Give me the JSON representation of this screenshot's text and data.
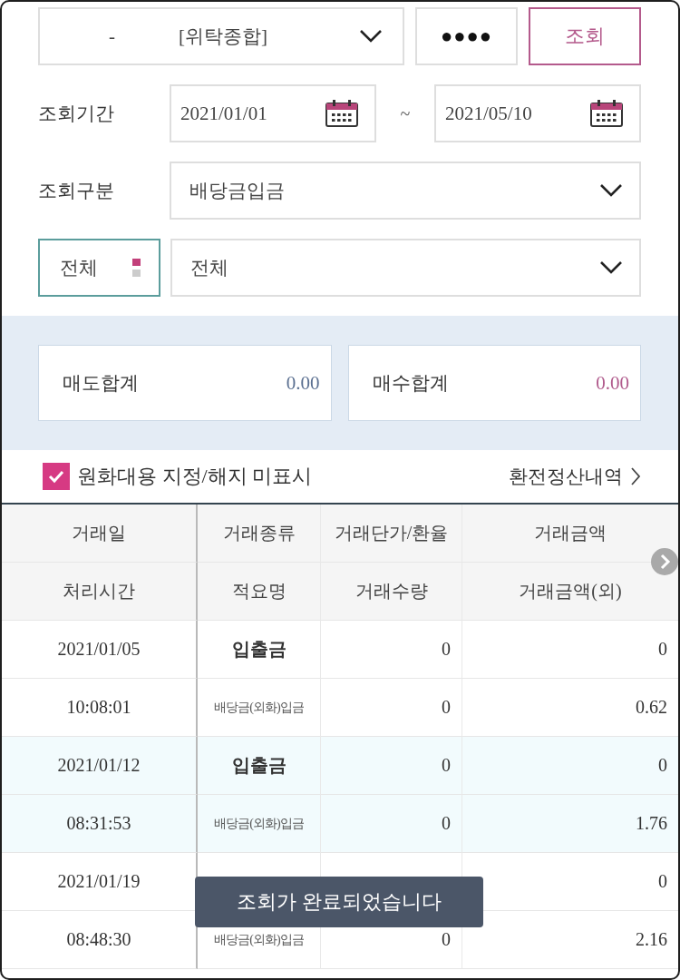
{
  "account": {
    "number": "-",
    "type": "[위탁종합]",
    "password": "●●●●",
    "search_button": "조회"
  },
  "period": {
    "label": "조회기간",
    "start": "2021/01/01",
    "separator": "~",
    "end": "2021/05/10"
  },
  "category": {
    "label": "조회구분",
    "value": "배당금입금"
  },
  "filter": {
    "scope": "전체",
    "value": "전체"
  },
  "totals": [
    {
      "label": "매도합계",
      "value": "0.00",
      "color": "#5b7091"
    },
    {
      "label": "매수합계",
      "value": "0.00",
      "color": "#b05a8c"
    }
  ],
  "option": {
    "label": "원화대용 지정/해지 미표시",
    "checked": true
  },
  "link": "환전정산내역",
  "table": {
    "header_rows": [
      [
        "거래일",
        "거래종류",
        "거래단가/환율",
        "거래금액"
      ],
      [
        "처리시간",
        "적요명",
        "거래수량",
        "거래금액(외)"
      ]
    ],
    "records": [
      {
        "date": "2021/01/05",
        "type": "입출금",
        "price": "0",
        "amount": "0",
        "time": "10:08:01",
        "summary": "배당금(외화)입금",
        "quantity": "0",
        "amount_foreign": "0.62"
      },
      {
        "date": "2021/01/12",
        "type": "입출금",
        "price": "0",
        "amount": "0",
        "time": "08:31:53",
        "summary": "배당금(외화)입금",
        "quantity": "0",
        "amount_foreign": "1.76"
      },
      {
        "date": "2021/01/19",
        "amount": "0",
        "time": "08:48:30",
        "summary": "배당금(외화)입금",
        "quantity": "0",
        "amount_foreign": "2.16"
      }
    ]
  },
  "toast": "조회가 완료되었습니다"
}
